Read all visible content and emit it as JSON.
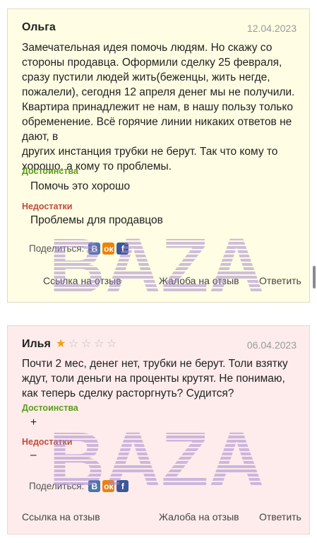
{
  "reviews": [
    {
      "author": "Ольга",
      "date": "12.04.2023",
      "text_lines": [
        "Замечательная идея помочь людям. Но скажу со",
        "стороны продавца. Оформили сделку 25 февраля,",
        "сразу пустили людей жить(беженцы, жить негде,",
        "пожалели), сегодня 12 апреля денег мы не получили.",
        "Квартира принадлежит не нам, в нашу пользу только",
        "обременение. Всё горячие линии никаких ответов не",
        "дают, в",
        "других инстанция трубки не берут. Так что кому то",
        "хорошо, а кому то проблемы."
      ],
      "pros_title": "Достоинства",
      "pros_text": "Помочь это хорошо",
      "cons_title": "Недостатки",
      "cons_text": "Проблемы для продавцов",
      "share_label": "Поделиться:",
      "link_review": "Ссылка на отзыв",
      "link_complaint": "Жалоба на отзыв",
      "link_reply": "Ответить"
    },
    {
      "author": "Илья",
      "date": "06.04.2023",
      "rating": 1,
      "rating_max": 5,
      "text_lines": [
        "Почти 2 мес, денег нет, трубки не берут. Толи взятку",
        "ждут, толи деньги на проценты крутят. Не понимаю,",
        "как теперь сделку расторгнуть? Судится?"
      ],
      "pros_title": "Достоинства",
      "pros_text": "+",
      "cons_title": "Недостатки",
      "cons_text": "–",
      "share_label": "Поделиться:",
      "link_review": "Ссылка на отзыв",
      "link_complaint": "Жалоба на отзыв",
      "link_reply": "Ответить"
    }
  ],
  "share_icons": [
    "vk-icon",
    "odnoklassniki-icon",
    "facebook-icon"
  ],
  "share_glyphs": {
    "vk": "В",
    "ok": "ок",
    "fb": "f"
  },
  "watermark": "BAZA",
  "colors": {
    "card1_bg": "#fffde3",
    "card2_bg": "#fdeceb",
    "pros": "#5d9b1c",
    "cons": "#c24a3b",
    "star": "#f2a100",
    "watermark": "#a58bd1"
  }
}
